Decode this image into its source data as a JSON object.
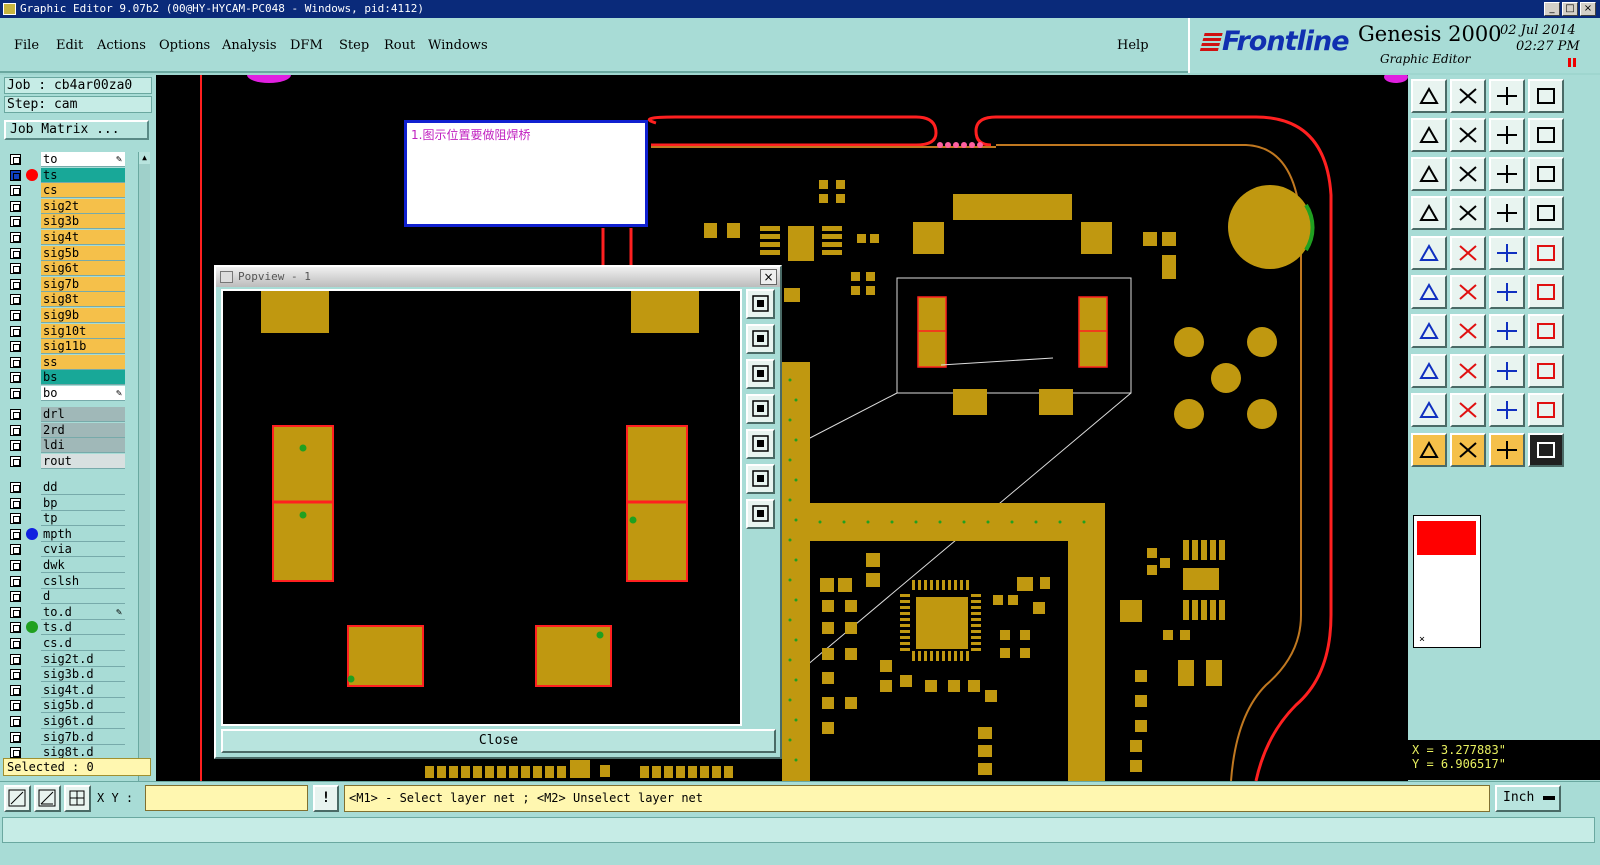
{
  "window": {
    "title": "Graphic Editor 9.07b2 (00@HY-HYCAM-PC048 - Windows, pid:4112)",
    "min_label": "_",
    "max_label": "□",
    "close_label": "×"
  },
  "menu": {
    "items": [
      "File",
      "Edit",
      "Actions",
      "Options",
      "Analysis",
      "DFM",
      "Step",
      "Rout",
      "Windows"
    ],
    "help": "Help"
  },
  "brand": {
    "logo": "Frontline",
    "product": "Genesis 2000",
    "subtitle": "Graphic Editor",
    "date": "02 Jul 2014",
    "time": "02:27 PM"
  },
  "job": {
    "job_label": "Job : cb4ar00za0",
    "step_label": "Step: cam",
    "matrix_button": "Job Matrix ..."
  },
  "layers": {
    "group1": [
      {
        "name": "to",
        "color": "#ffffff",
        "dot": "",
        "pen": true
      },
      {
        "name": "ts",
        "color": "#18a898",
        "dot": "#ff0000",
        "pen": false,
        "active": true
      },
      {
        "name": "cs",
        "color": "#f5c04a",
        "dot": "",
        "pen": false
      },
      {
        "name": "sig2t",
        "color": "#f5c04a",
        "dot": "",
        "pen": false
      },
      {
        "name": "sig3b",
        "color": "#f5c04a",
        "dot": "",
        "pen": false
      },
      {
        "name": "sig4t",
        "color": "#f5c04a",
        "dot": "",
        "pen": false
      },
      {
        "name": "sig5b",
        "color": "#f5c04a",
        "dot": "",
        "pen": false
      },
      {
        "name": "sig6t",
        "color": "#f5c04a",
        "dot": "",
        "pen": false
      },
      {
        "name": "sig7b",
        "color": "#f5c04a",
        "dot": "",
        "pen": false
      },
      {
        "name": "sig8t",
        "color": "#f5c04a",
        "dot": "",
        "pen": false
      },
      {
        "name": "sig9b",
        "color": "#f5c04a",
        "dot": "",
        "pen": false
      },
      {
        "name": "sig10t",
        "color": "#f5c04a",
        "dot": "",
        "pen": false
      },
      {
        "name": "sig11b",
        "color": "#f5c04a",
        "dot": "",
        "pen": false
      },
      {
        "name": "ss",
        "color": "#f5c04a",
        "dot": "",
        "pen": false
      },
      {
        "name": "bs",
        "color": "#18a898",
        "dot": "",
        "pen": false
      },
      {
        "name": "bo",
        "color": "#ffffff",
        "dot": "",
        "pen": true
      }
    ],
    "group2": [
      {
        "name": "drl",
        "color": "#a0b8b8",
        "dot": "",
        "pen": false
      },
      {
        "name": "2rd",
        "color": "#a0b8b8",
        "dot": "",
        "pen": false
      },
      {
        "name": "ldi",
        "color": "#a0b8b8",
        "dot": "",
        "pen": false
      },
      {
        "name": "rout",
        "color": "#d8e0e0",
        "dot": "",
        "pen": false
      }
    ],
    "group3": [
      {
        "name": "dd",
        "color": "#a8dcd6",
        "dot": "",
        "pen": false
      },
      {
        "name": "bp",
        "color": "#a8dcd6",
        "dot": "",
        "pen": false
      },
      {
        "name": "tp",
        "color": "#a8dcd6",
        "dot": "",
        "pen": false
      },
      {
        "name": "mpth",
        "color": "#a8dcd6",
        "dot": "#1020e0",
        "pen": false
      },
      {
        "name": "cvia",
        "color": "#a8dcd6",
        "dot": "",
        "pen": false
      },
      {
        "name": "dwk",
        "color": "#a8dcd6",
        "dot": "",
        "pen": false
      },
      {
        "name": "cslsh",
        "color": "#a8dcd6",
        "dot": "",
        "pen": false
      },
      {
        "name": "d",
        "color": "#a8dcd6",
        "dot": "",
        "pen": false
      },
      {
        "name": "to.d",
        "color": "#a8dcd6",
        "dot": "",
        "pen": true
      },
      {
        "name": "ts.d",
        "color": "#a8dcd6",
        "dot": "#20a020",
        "pen": false
      },
      {
        "name": "cs.d",
        "color": "#a8dcd6",
        "dot": "",
        "pen": false
      },
      {
        "name": "sig2t.d",
        "color": "#a8dcd6",
        "dot": "",
        "pen": false
      },
      {
        "name": "sig3b.d",
        "color": "#a8dcd6",
        "dot": "",
        "pen": false
      },
      {
        "name": "sig4t.d",
        "color": "#a8dcd6",
        "dot": "",
        "pen": false
      },
      {
        "name": "sig5b.d",
        "color": "#a8dcd6",
        "dot": "",
        "pen": false
      },
      {
        "name": "sig6t.d",
        "color": "#a8dcd6",
        "dot": "",
        "pen": false
      },
      {
        "name": "sig7b.d",
        "color": "#a8dcd6",
        "dot": "",
        "pen": false
      },
      {
        "name": "sig8t.d",
        "color": "#a8dcd6",
        "dot": "",
        "pen": false
      }
    ]
  },
  "selected": "Selected : 0",
  "note": {
    "text": "1.图示位置要做阻焊桥"
  },
  "popview": {
    "title": "Popview - 1",
    "close_button": "Close"
  },
  "coords": {
    "x": "X = 3.277883\"",
    "y": "Y = 6.906517\""
  },
  "statusbar": {
    "xy_label": "X Y :",
    "xy_value": "",
    "alert_icon": "!",
    "message": "<M1> - Select layer net ; <M2> Unselect layer net",
    "units": "Inch"
  },
  "colors": {
    "pad": "#c09810",
    "trace_red": "#ff2020",
    "background": "#a8dcd6",
    "active_layer": "#ff0000"
  }
}
